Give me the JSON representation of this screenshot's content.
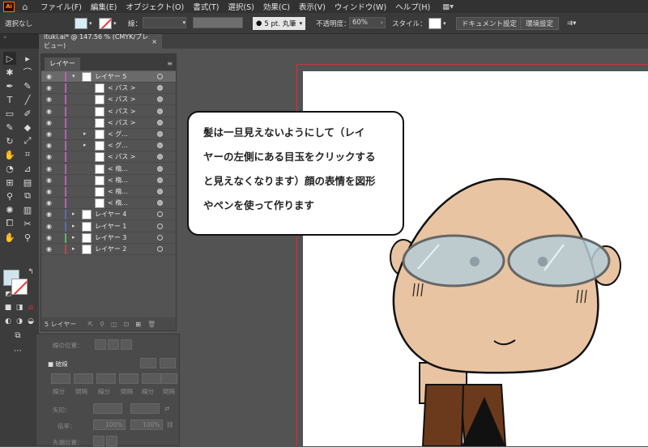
{
  "menu": {
    "app_icon": "Ai",
    "items": [
      "ファイル(F)",
      "編集(E)",
      "オブジェクト(O)",
      "書式(T)",
      "選択(S)",
      "効果(C)",
      "表示(V)",
      "ウィンドウ(W)",
      "ヘルプ(H)"
    ]
  },
  "control_bar": {
    "selection": "選択なし",
    "stroke_label": "線：",
    "brush": "5 pt. 丸筆",
    "opacity_label": "不透明度：",
    "opacity_value": "60%",
    "style_label": "スタイル：",
    "doc_settings": "ドキュメント設定",
    "prefs": "環境設定"
  },
  "document_tab": {
    "title": "ituki.ai* @ 147.56 % (CMYK/プレビュー)",
    "close": "×"
  },
  "layers_panel": {
    "tab": "レイヤー",
    "footer": "5 レイヤー",
    "rows": [
      {
        "name": "レイヤー 5",
        "level": 0,
        "expanded": true,
        "color": "#ca52c9"
      },
      {
        "name": "< パス >",
        "level": 1,
        "color": "#ca52c9"
      },
      {
        "name": "< パス >",
        "level": 1,
        "color": "#ca52c9"
      },
      {
        "name": "< パス >",
        "level": 1,
        "color": "#ca52c9"
      },
      {
        "name": "< パス >",
        "level": 1,
        "color": "#ca52c9"
      },
      {
        "name": "< グ...",
        "level": 1,
        "group": true,
        "color": "#ca52c9"
      },
      {
        "name": "< グ...",
        "level": 1,
        "group": true,
        "color": "#ca52c9"
      },
      {
        "name": "< パス >",
        "level": 1,
        "color": "#ca52c9"
      },
      {
        "name": "< 楕...",
        "level": 1,
        "color": "#ca52c9"
      },
      {
        "name": "< 楕...",
        "level": 1,
        "color": "#ca52c9"
      },
      {
        "name": "< 楕...",
        "level": 1,
        "color": "#ca52c9"
      },
      {
        "name": "< 楕...",
        "level": 1,
        "color": "#ca52c9"
      },
      {
        "name": "レイヤー 4",
        "level": 0,
        "color": "#4f6bd6"
      },
      {
        "name": "レイヤー 1",
        "level": 0,
        "color": "#4f6bd6"
      },
      {
        "name": "レイヤー 3",
        "level": 0,
        "color": "#4fc24f"
      },
      {
        "name": "レイヤー 2",
        "level": 0,
        "color": "#e0393f"
      }
    ]
  },
  "background_panel": {
    "align": "線の位置：",
    "dashed": "破線",
    "labels": [
      "線分",
      "間隔",
      "線分",
      "間隔",
      "線分",
      "間隔"
    ],
    "arrow": "矢印：",
    "scale": "倍率：",
    "scale1": "100%",
    "scale2": "100%",
    "tip": "先端位置："
  },
  "callout": {
    "lines": [
      "髪は一旦見えないようにして（レイ",
      "ヤーの左側にある目玉をクリックする",
      "と見えなくなります）顔の表情を図形",
      "やペンを使って作ります"
    ]
  },
  "colors": {
    "skin": "#e8c4a2",
    "glasses": "#b5cdd6",
    "shirt": "#6b3a1c"
  }
}
